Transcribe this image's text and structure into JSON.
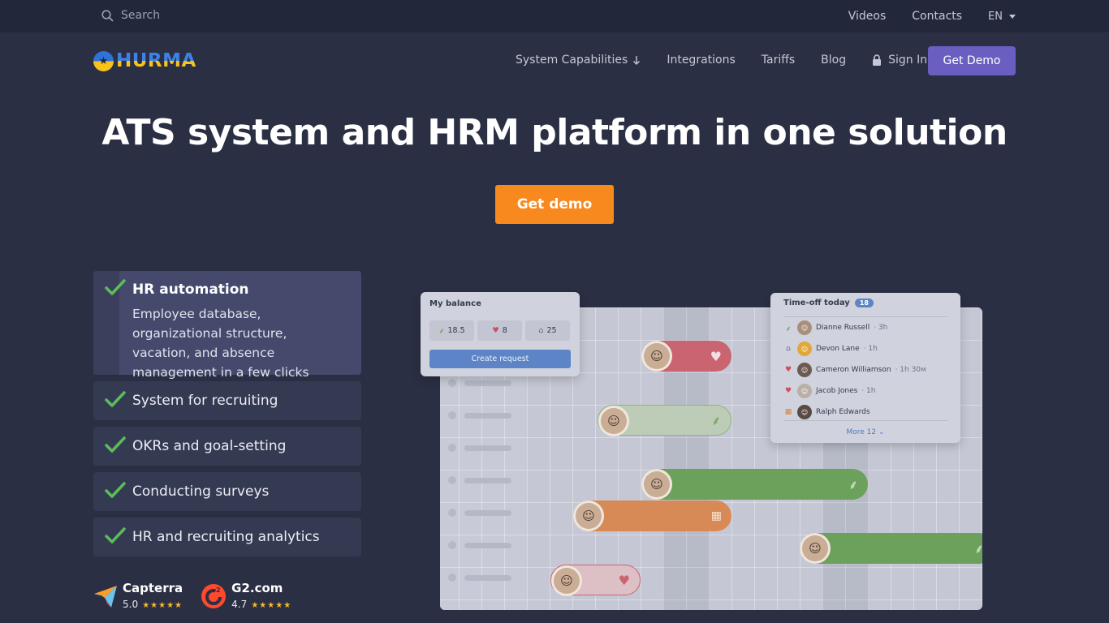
{
  "topbar": {
    "search_placeholder": "Search",
    "links": [
      "Videos",
      "Contacts"
    ],
    "language": "EN"
  },
  "header": {
    "logo_text": "HURMA",
    "nav": {
      "system_capabilities": "System Capabilities",
      "integrations": "Integrations",
      "tariffs": "Tariffs",
      "blog": "Blog",
      "sign_in": "Sign In"
    },
    "cta": "Get Demo"
  },
  "hero": {
    "title": "ATS system and HRM platform in one solution",
    "cta": "Get demo"
  },
  "features": [
    {
      "title": "HR automation",
      "description": "Employee database, organizational structure, vacation, and absence management in a few clicks"
    },
    {
      "title": "System for recruiting"
    },
    {
      "title": "OKRs and goal-setting"
    },
    {
      "title": "Conducting surveys"
    },
    {
      "title": "HR and recruiting analytics"
    }
  ],
  "ratings": [
    {
      "name": "Capterra",
      "score": "5.0",
      "stars": "★★★★★"
    },
    {
      "name": "G2.com",
      "score": "4.7",
      "stars": "★★★★★"
    }
  ],
  "illustration": {
    "balance": {
      "title": "My balance",
      "values": [
        "18.5",
        "8",
        "25"
      ],
      "button": "Create request"
    },
    "timeoff": {
      "title": "Time-off today",
      "count": "18",
      "people": [
        {
          "name": "Dianne Russell",
          "meta": "· 3h",
          "icon": "palm-icon"
        },
        {
          "name": "Devon Lane",
          "meta": "· 1h",
          "icon": "home-icon"
        },
        {
          "name": "Cameron Williamson",
          "meta": "· 1h 30м",
          "icon": "heart-icon"
        },
        {
          "name": "Jacob Jones",
          "meta": "· 1h",
          "icon": "heart-icon"
        },
        {
          "name": "Ralph Edwards",
          "meta": "",
          "icon": "calendar-icon"
        }
      ],
      "more": "More 12"
    }
  },
  "colors": {
    "page_bg": "#2b2f43",
    "topbar_bg": "#23273a",
    "accent_purple": "#6a5fc1",
    "accent_orange": "#f7891f",
    "check_green": "#5bbd5a"
  }
}
